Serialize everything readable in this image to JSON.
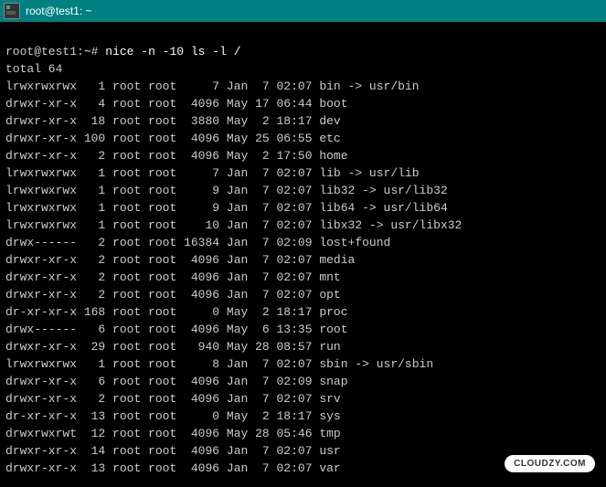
{
  "titlebar": {
    "title": "root@test1: ~"
  },
  "prompt": {
    "user_host": "root@test1:",
    "path": "~",
    "symbol": "#",
    "command": "nice -n -10 ls -l /"
  },
  "total_line": "total 64",
  "listing": [
    {
      "perm": "lrwxrwxrwx",
      "links": "1",
      "owner": "root",
      "group": "root",
      "size": "7",
      "month": "Jan",
      "day": "7",
      "time": "02:07",
      "name": "bin -> usr/bin",
      "month_hl": false
    },
    {
      "perm": "drwxr-xr-x",
      "links": "4",
      "owner": "root",
      "group": "root",
      "size": "4096",
      "month": "May",
      "day": "17",
      "time": "06:44",
      "name": "boot",
      "month_hl": true
    },
    {
      "perm": "drwxr-xr-x",
      "links": "18",
      "owner": "root",
      "group": "root",
      "size": "3880",
      "month": "May",
      "day": "2",
      "time": "18:17",
      "name": "dev",
      "month_hl": true
    },
    {
      "perm": "drwxr-xr-x",
      "links": "100",
      "owner": "root",
      "group": "root",
      "size": "4096",
      "month": "May",
      "day": "25",
      "time": "06:55",
      "name": "etc",
      "month_hl": true
    },
    {
      "perm": "drwxr-xr-x",
      "links": "2",
      "owner": "root",
      "group": "root",
      "size": "4096",
      "month": "May",
      "day": "2",
      "time": "17:50",
      "name": "home",
      "month_hl": true
    },
    {
      "perm": "lrwxrwxrwx",
      "links": "1",
      "owner": "root",
      "group": "root",
      "size": "7",
      "month": "Jan",
      "day": "7",
      "time": "02:07",
      "name": "lib -> usr/lib",
      "month_hl": false
    },
    {
      "perm": "lrwxrwxrwx",
      "links": "1",
      "owner": "root",
      "group": "root",
      "size": "9",
      "month": "Jan",
      "day": "7",
      "time": "02:07",
      "name": "lib32 -> usr/lib32",
      "month_hl": false
    },
    {
      "perm": "lrwxrwxrwx",
      "links": "1",
      "owner": "root",
      "group": "root",
      "size": "9",
      "month": "Jan",
      "day": "7",
      "time": "02:07",
      "name": "lib64 -> usr/lib64",
      "month_hl": false
    },
    {
      "perm": "lrwxrwxrwx",
      "links": "1",
      "owner": "root",
      "group": "root",
      "size": "10",
      "month": "Jan",
      "day": "7",
      "time": "02:07",
      "name": "libx32 -> usr/libx32",
      "month_hl": false
    },
    {
      "perm": "drwx------",
      "links": "2",
      "owner": "root",
      "group": "root",
      "size": "16384",
      "month": "Jan",
      "day": "7",
      "time": "02:09",
      "name": "lost+found",
      "month_hl": false
    },
    {
      "perm": "drwxr-xr-x",
      "links": "2",
      "owner": "root",
      "group": "root",
      "size": "4096",
      "month": "Jan",
      "day": "7",
      "time": "02:07",
      "name": "media",
      "month_hl": false
    },
    {
      "perm": "drwxr-xr-x",
      "links": "2",
      "owner": "root",
      "group": "root",
      "size": "4096",
      "month": "Jan",
      "day": "7",
      "time": "02:07",
      "name": "mnt",
      "month_hl": false
    },
    {
      "perm": "drwxr-xr-x",
      "links": "2",
      "owner": "root",
      "group": "root",
      "size": "4096",
      "month": "Jan",
      "day": "7",
      "time": "02:07",
      "name": "opt",
      "month_hl": false
    },
    {
      "perm": "dr-xr-xr-x",
      "links": "168",
      "owner": "root",
      "group": "root",
      "size": "0",
      "month": "May",
      "day": "2",
      "time": "18:17",
      "name": "proc",
      "month_hl": true
    },
    {
      "perm": "drwx------",
      "links": "6",
      "owner": "root",
      "group": "root",
      "size": "4096",
      "month": "May",
      "day": "6",
      "time": "13:35",
      "name": "root",
      "month_hl": true
    },
    {
      "perm": "drwxr-xr-x",
      "links": "29",
      "owner": "root",
      "group": "root",
      "size": "940",
      "month": "May",
      "day": "28",
      "time": "08:57",
      "name": "run",
      "month_hl": true
    },
    {
      "perm": "lrwxrwxrwx",
      "links": "1",
      "owner": "root",
      "group": "root",
      "size": "8",
      "month": "Jan",
      "day": "7",
      "time": "02:07",
      "name": "sbin -> usr/sbin",
      "month_hl": false
    },
    {
      "perm": "drwxr-xr-x",
      "links": "6",
      "owner": "root",
      "group": "root",
      "size": "4096",
      "month": "Jan",
      "day": "7",
      "time": "02:09",
      "name": "snap",
      "month_hl": false
    },
    {
      "perm": "drwxr-xr-x",
      "links": "2",
      "owner": "root",
      "group": "root",
      "size": "4096",
      "month": "Jan",
      "day": "7",
      "time": "02:07",
      "name": "srv",
      "month_hl": false
    },
    {
      "perm": "dr-xr-xr-x",
      "links": "13",
      "owner": "root",
      "group": "root",
      "size": "0",
      "month": "May",
      "day": "2",
      "time": "18:17",
      "name": "sys",
      "month_hl": true
    },
    {
      "perm": "drwxrwxrwt",
      "links": "12",
      "owner": "root",
      "group": "root",
      "size": "4096",
      "month": "May",
      "day": "28",
      "time": "05:46",
      "name": "tmp",
      "month_hl": true
    },
    {
      "perm": "drwxr-xr-x",
      "links": "14",
      "owner": "root",
      "group": "root",
      "size": "4096",
      "month": "Jan",
      "day": "7",
      "time": "02:07",
      "name": "usr",
      "month_hl": false
    },
    {
      "perm": "drwxr-xr-x",
      "links": "13",
      "owner": "root",
      "group": "root",
      "size": "4096",
      "month": "Jan",
      "day": "7",
      "time": "02:07",
      "name": "var",
      "month_hl": false
    }
  ],
  "badge": {
    "text": "CLOUDZY.COM"
  }
}
